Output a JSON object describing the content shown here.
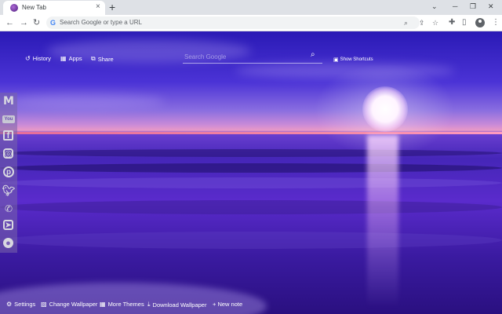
{
  "browser": {
    "tab_title": "New Tab",
    "tab_close": "×",
    "new_tab": "+",
    "omnibox_placeholder": "Search Google or type a URL",
    "google_g": "G"
  },
  "page": {
    "nav": {
      "history": "History",
      "apps": "Apps",
      "share": "Share"
    },
    "search_placeholder": "Search Google",
    "show_shortcuts": "Show Shortcuts",
    "social_icons": [
      "gmail-icon",
      "youtube-icon",
      "facebook-icon",
      "instagram-icon",
      "pinterest-icon",
      "twitter-icon",
      "whatsapp-icon",
      "telegram-icon",
      "reddit-icon"
    ],
    "bottom": {
      "settings": "Settings",
      "change_wallpaper": "Change Wallpaper",
      "more_themes": "More Themes",
      "download_wallpaper": "Download Wallpaper",
      "new_note": "+ New note"
    }
  },
  "colors": {
    "sky": "#2a1ab5",
    "horizon": "#f48aa8",
    "sea": "#4526b8",
    "accent_google": "#4285f4"
  }
}
